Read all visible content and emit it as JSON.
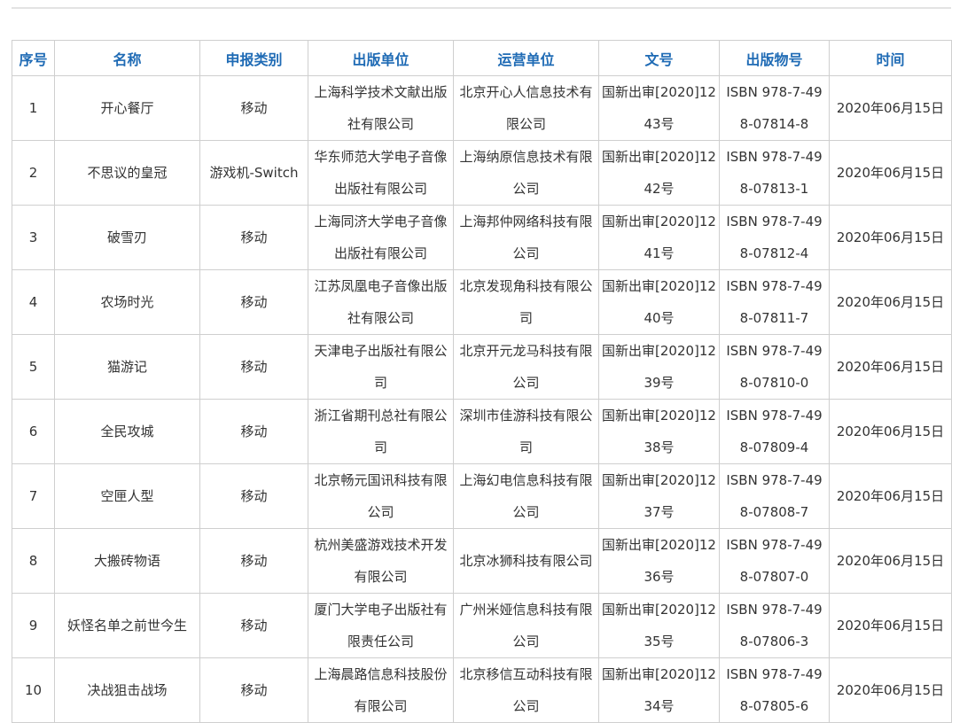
{
  "columns": [
    "序号",
    "名称",
    "申报类别",
    "出版单位",
    "运营单位",
    "文号",
    "出版物号",
    "时间"
  ],
  "rows": [
    [
      "1",
      "开心餐厅",
      "移动",
      "上海科学技术文献出版社有限公司",
      "北京开心人信息技术有限公司",
      "国新出审[2020]1243号",
      "ISBN 978-7-498-07814-8",
      "2020年06月15日"
    ],
    [
      "2",
      "不思议的皇冠",
      "游戏机-Switch",
      "华东师范大学电子音像出版社有限公司",
      "上海纳原信息技术有限公司",
      "国新出审[2020]1242号",
      "ISBN 978-7-498-07813-1",
      "2020年06月15日"
    ],
    [
      "3",
      "破雪刃",
      "移动",
      "上海同济大学电子音像出版社有限公司",
      "上海邦仲网络科技有限公司",
      "国新出审[2020]1241号",
      "ISBN 978-7-498-07812-4",
      "2020年06月15日"
    ],
    [
      "4",
      "农场时光",
      "移动",
      "江苏凤凰电子音像出版社有限公司",
      "北京发现角科技有限公司",
      "国新出审[2020]1240号",
      "ISBN 978-7-498-07811-7",
      "2020年06月15日"
    ],
    [
      "5",
      "猫游记",
      "移动",
      "天津电子出版社有限公司",
      "北京开元龙马科技有限公司",
      "国新出审[2020]1239号",
      "ISBN 978-7-498-07810-0",
      "2020年06月15日"
    ],
    [
      "6",
      "全民攻城",
      "移动",
      "浙江省期刊总社有限公司",
      "深圳市佳游科技有限公司",
      "国新出审[2020]1238号",
      "ISBN 978-7-498-07809-4",
      "2020年06月15日"
    ],
    [
      "7",
      "空匣人型",
      "移动",
      "北京畅元国讯科技有限公司",
      "上海幻电信息科技有限公司",
      "国新出审[2020]1237号",
      "ISBN 978-7-498-07808-7",
      "2020年06月15日"
    ],
    [
      "8",
      "大搬砖物语",
      "移动",
      "杭州美盛游戏技术开发有限公司",
      "北京冰狮科技有限公司",
      "国新出审[2020]1236号",
      "ISBN 978-7-498-07807-0",
      "2020年06月15日"
    ],
    [
      "9",
      "妖怪名单之前世今生",
      "移动",
      "厦门大学电子出版社有限责任公司",
      "广州米娅信息科技有限公司",
      "国新出审[2020]1235号",
      "ISBN 978-7-498-07806-3",
      "2020年06月15日"
    ],
    [
      "10",
      "决战狙击战场",
      "移动",
      "上海晨路信息科技股份有限公司",
      "北京移信互动科技有限公司",
      "国新出审[2020]1234号",
      "ISBN 978-7-498-07805-6",
      "2020年06月15日"
    ]
  ]
}
